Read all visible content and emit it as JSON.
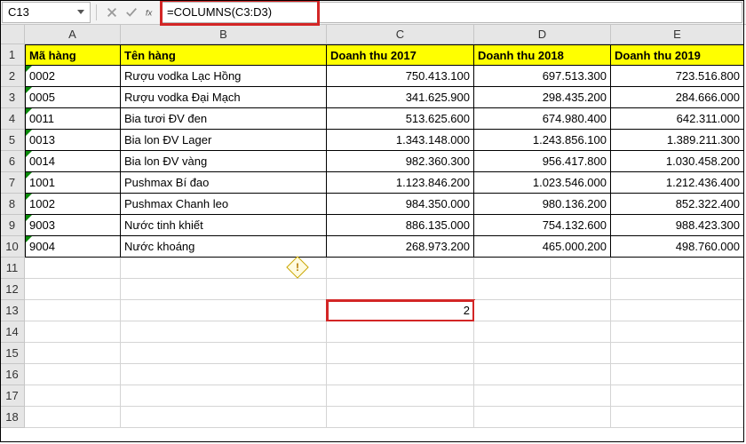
{
  "formula_bar": {
    "cell_ref": "C13",
    "formula": "=COLUMNS(C3:D3)"
  },
  "columns": [
    "A",
    "B",
    "C",
    "D",
    "E"
  ],
  "row_numbers": [
    "1",
    "2",
    "3",
    "4",
    "5",
    "6",
    "7",
    "8",
    "9",
    "10",
    "11",
    "12",
    "13",
    "14",
    "15",
    "16",
    "17",
    "18"
  ],
  "headers": {
    "a": "Mã hàng",
    "b": "Tên hàng",
    "c": "Doanh thu 2017",
    "d": "Doanh thu 2018",
    "e": "Doanh thu 2019"
  },
  "rows": [
    {
      "a": "0002",
      "b": "Rượu vodka Lạc Hồng",
      "c": "750.413.100",
      "d": "697.513.300",
      "e": "723.516.800"
    },
    {
      "a": "0005",
      "b": "Rượu vodka Đại Mạch",
      "c": "341.625.900",
      "d": "298.435.200",
      "e": "284.666.000"
    },
    {
      "a": "0011",
      "b": "Bia tươi ĐV đen",
      "c": "513.625.600",
      "d": "674.980.400",
      "e": "642.311.000"
    },
    {
      "a": "0013",
      "b": "Bia lon ĐV Lager",
      "c": "1.343.148.000",
      "d": "1.243.856.100",
      "e": "1.389.211.300"
    },
    {
      "a": "0014",
      "b": "Bia lon ĐV vàng",
      "c": "982.360.300",
      "d": "956.417.800",
      "e": "1.030.458.200"
    },
    {
      "a": "1001",
      "b": "Pushmax Bí đao",
      "c": "1.123.846.200",
      "d": "1.023.546.000",
      "e": "1.212.436.400"
    },
    {
      "a": "1002",
      "b": "Pushmax Chanh leo",
      "c": "984.350.000",
      "d": "980.136.200",
      "e": "852.322.400"
    },
    {
      "a": "9003",
      "b": "Nước tinh khiết",
      "c": "886.135.000",
      "d": "754.132.600",
      "e": "988.423.300"
    },
    {
      "a": "9004",
      "b": "Nước khoáng",
      "c": "268.973.200",
      "d": "465.000.200",
      "e": "498.760.000"
    }
  ],
  "result_cell": {
    "value": "2"
  },
  "error_indicator": {
    "symbol": "!"
  }
}
